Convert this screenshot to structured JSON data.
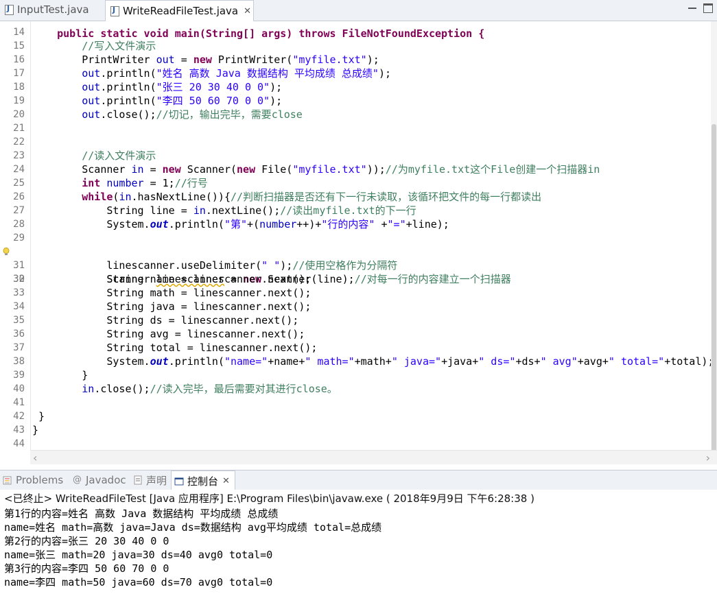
{
  "editor_tabs": [
    {
      "label": "InputTest.java",
      "active": false
    },
    {
      "label": "WriteReadFileTest.java",
      "active": true
    }
  ],
  "code_partial_first_line": "    public static void main(String[] args) throws FileNotFoundException {",
  "code_lines": [
    {
      "n": "14"
    },
    {
      "n": "15"
    },
    {
      "n": "16"
    },
    {
      "n": "17"
    },
    {
      "n": "18"
    },
    {
      "n": "19"
    },
    {
      "n": "20"
    },
    {
      "n": "21"
    },
    {
      "n": "22"
    },
    {
      "n": "23"
    },
    {
      "n": "24"
    },
    {
      "n": "25"
    },
    {
      "n": "26"
    },
    {
      "n": "27"
    },
    {
      "n": "28"
    },
    {
      "n": "29"
    },
    {
      "n": "30"
    },
    {
      "n": "31"
    },
    {
      "n": "32"
    },
    {
      "n": "33"
    },
    {
      "n": "34"
    },
    {
      "n": "35"
    },
    {
      "n": "36"
    },
    {
      "n": "37"
    },
    {
      "n": "38"
    },
    {
      "n": "39"
    },
    {
      "n": "40"
    },
    {
      "n": "41"
    },
    {
      "n": "42"
    },
    {
      "n": "43"
    },
    {
      "n": "44"
    }
  ],
  "panel_tabs": [
    {
      "label": "Problems",
      "icon": "problems-icon",
      "active": false
    },
    {
      "label": "Javadoc",
      "icon": "javadoc-icon",
      "active": false
    },
    {
      "label": "声明",
      "icon": "declaration-icon",
      "active": false
    },
    {
      "label": "控制台",
      "icon": "console-icon",
      "active": true
    }
  ],
  "console": {
    "header": "<已终止> WriteReadFileTest [Java 应用程序] E:\\Program Files\\bin\\javaw.exe ( 2018年9月9日 下午6:28:38 )",
    "lines": [
      "第1行的内容=姓名 高数 Java 数据结构 平均成绩 总成绩",
      "name=姓名 math=高数 java=Java ds=数据结构 avg平均成绩 total=总成绩",
      "第2行的内容=张三 20 30 40 0 0",
      "name=张三 math=20 java=30 ds=40 avg0 total=0",
      "第3行的内容=李四 50 60 70 0 0",
      "name=李四 math=50 java=60 ds=70 avg0 total=0"
    ]
  },
  "colors": {
    "keyword": "#7f0055",
    "string": "#2a00ff",
    "comment": "#3f7f5f",
    "field": "#0000c0"
  },
  "code_text": {
    "l15_comment": "//写入文件演示",
    "l16_a": "PrintWriter ",
    "l16_var": "out",
    "l16_b": " = ",
    "l16_kw": "new",
    "l16_c": " PrintWriter(",
    "l16_str": "\"myfile.txt\"",
    "l16_d": ");",
    "l17_a": "out",
    "l17_b": ".println(",
    "l17_str": "\"姓名 高数 Java 数据结构 平均成绩 总成绩\"",
    "l17_c": ");",
    "l18_a": "out",
    "l18_b": ".println(",
    "l18_str": "\"张三 20 30 40 0 0\"",
    "l18_c": ");",
    "l19_a": "out",
    "l19_b": ".println(",
    "l19_str": "\"李四 50 60 70 0 0\"",
    "l19_c": ");",
    "l20_a": "out",
    "l20_b": ".close();",
    "l20_cm": "//切记，输出完毕，需要close",
    "l23_comment": "//读入文件演示",
    "l24_a": "Scanner ",
    "l24_var": "in",
    "l24_b": " = ",
    "l24_kw": "new",
    "l24_c": " Scanner(",
    "l24_kw2": "new",
    "l24_d": " File(",
    "l24_str": "\"myfile.txt\"",
    "l24_e": "));",
    "l24_cm": "//为myfile.txt这个File创建一个扫描器in",
    "l25_kw": "int",
    "l25_a": " ",
    "l25_var": "number",
    "l25_b": " = 1;",
    "l25_cm": "//行号",
    "l26_kw": "while",
    "l26_a": "(",
    "l26_var": "in",
    "l26_b": ".hasNextLine()){",
    "l26_cm": "//判断扫描器是否还有下一行未读取，该循环把文件的每一行都读出",
    "l27_a": "String ",
    "l27_var": "line",
    "l27_b": " = ",
    "l27_var2": "in",
    "l27_c": ".nextLine();",
    "l27_cm": "//读出myfile.txt的下一行",
    "l28_a": "System.",
    "l28_sf": "out",
    "l28_b": ".println(",
    "l28_s1": "\"第\"",
    "l28_c": "+(",
    "l28_var": "number",
    "l28_d": "++)+",
    "l28_s2": "\"行的内容\"",
    "l28_e": " +",
    "l28_s3": "\"=\"",
    "l28_f": "+",
    "l28_var2": "line",
    "l28_g": ");",
    "l30_a": "Scanner ",
    "l30_var": "linescanner",
    "l30_b": " = ",
    "l30_kw": "new",
    "l30_c": " Scanner(",
    "l30_var2": "line",
    "l30_d": ");",
    "l30_cm": "//对每一行的内容建立一个扫描器",
    "l31_var": "linescanner",
    "l31_a": ".useDelimiter(",
    "l31_str": "\" \"",
    "l31_b": ");",
    "l31_cm": "//使用空格作为分隔符",
    "l32_a": "String ",
    "l32_var": "name",
    "l32_b": " = ",
    "l32_var2": "linescanner",
    "l32_c": ".next();",
    "l33_a": "String ",
    "l33_var": "math",
    "l33_b": " = ",
    "l33_var2": "linescanner",
    "l33_c": ".next();",
    "l34_a": "String ",
    "l34_var": "java",
    "l34_b": " = ",
    "l34_var2": "linescanner",
    "l34_c": ".next();",
    "l35_a": "String ",
    "l35_var": "ds",
    "l35_b": " = ",
    "l35_var2": "linescanner",
    "l35_c": ".next();",
    "l36_a": "String ",
    "l36_var": "avg",
    "l36_b": " = ",
    "l36_var2": "linescanner",
    "l36_c": ".next();",
    "l37_a": "String ",
    "l37_var": "total",
    "l37_b": " = ",
    "l37_var2": "linescanner",
    "l37_c": ".next();",
    "l38_a": "System.",
    "l38_sf": "out",
    "l38_b": ".println(",
    "l38_s1": "\"name=\"",
    "l38_c": "+",
    "l38_v1": "name",
    "l38_d": "+",
    "l38_s2": "\" math=\"",
    "l38_e": "+",
    "l38_v2": "math",
    "l38_f": "+",
    "l38_s3": "\" java=\"",
    "l38_g": "+",
    "l38_v3": "java",
    "l38_h": "+",
    "l38_s4": "\" ds=\"",
    "l38_i": "+",
    "l38_v4": "ds",
    "l38_j": "+",
    "l38_s5": "\" avg\"",
    "l38_k": "+",
    "l38_v5": "avg",
    "l38_l": "+",
    "l38_s6": "\" total=\"",
    "l38_m": "+",
    "l38_v6": "total",
    "l38_n": ");",
    "l39": "}",
    "l40_var": "in",
    "l40_a": ".close();",
    "l40_cm": "//读入完毕，最后需要对其进行close。",
    "l42": "}",
    "l43": "}"
  }
}
